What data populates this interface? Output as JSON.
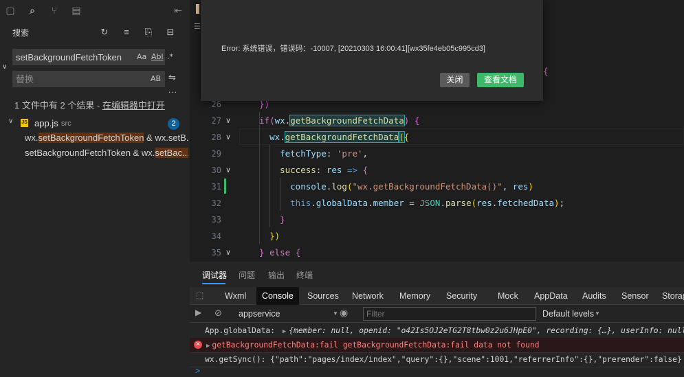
{
  "sidebar": {
    "title": "搜索",
    "search": {
      "value": "setBackgroundFetchToken",
      "opt_case": "Aa",
      "opt_word": "Abl",
      "opt_regex": ".*"
    },
    "replace": {
      "placeholder": "替换",
      "opt_preserve": "AB"
    },
    "more": "...",
    "summary": "1 文件中有 2 个结果 - ",
    "summary_link": "在编辑器中打开",
    "file": {
      "name": "app.js",
      "dir": "src",
      "count": "2",
      "badge": "JS"
    },
    "matches": [
      {
        "pre": "wx.",
        "hit": "setBackgroundFetchToken",
        "post": " & wx.setB..."
      },
      {
        "pre": "setBackgroundFetchToken & wx.",
        "hit": "setBac...",
        "post": ""
      }
    ]
  },
  "modal": {
    "message": "Error: 系统错误，错误码：-10007, [20210303 16:00:41][wx35fe4eb05c995cd3]",
    "close_label": "关闭",
    "docs_label": "查看文档"
  },
  "editor": {
    "line_numbers": [
      "26",
      "27",
      "28",
      "29",
      "30",
      "31",
      "32",
      "33",
      "34",
      "35"
    ],
    "colors": {
      "added_marker": "#3cba6a",
      "match_outline": "#26a5a5"
    }
  },
  "devtools": {
    "tabs": [
      "调试器",
      "问题",
      "输出",
      "终端"
    ],
    "panels": [
      "Wxml",
      "Console",
      "Sources",
      "Network",
      "Memory",
      "Security",
      "Mock",
      "AppData",
      "Audits",
      "Sensor",
      "Storag"
    ],
    "context": "appservice",
    "filter_placeholder": "Filter",
    "levels": "Default levels",
    "console": [
      {
        "label": "App.globalData:",
        "value": "{member: null, openid: \"o42Is5OJ2eTG2T8tbw0z2u6JHpE0\", recording: {…}, userInfo: null,"
      },
      {
        "value": "getBackgroundFetchData:fail getBackgroundFetchData:fail data not found"
      },
      {
        "value": "wx.getSync(): {\"path\":\"pages/index/index\",\"query\":{},\"scene\":1001,\"referrerInfo\":{},\"prerender\":false}"
      }
    ],
    "prompt": ">"
  }
}
